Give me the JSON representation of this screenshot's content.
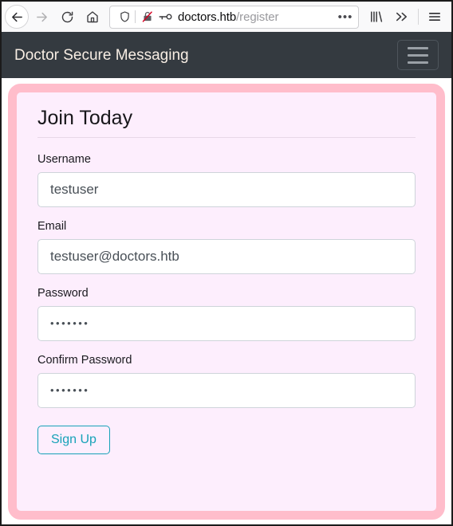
{
  "browser": {
    "back_label": "Back",
    "forward_label": "Forward",
    "reload_label": "Reload",
    "home_label": "Home",
    "url_host": "doctors.htb",
    "url_path": "/register",
    "page_actions_label": "•••",
    "shield_icon": "shield-icon",
    "broken_lock_icon": "broken-padlock-icon",
    "key_icon": "key-icon",
    "library_icon": "library-icon",
    "overflow_icon": "double-chevron-right-icon",
    "menu_icon": "hamburger-menu-icon"
  },
  "navbar": {
    "brand": "Doctor Secure Messaging",
    "toggler_label": "Toggle navigation"
  },
  "card": {
    "heading": "Join Today",
    "fields": [
      {
        "label": "Username",
        "value": "testuser",
        "placeholder": "",
        "type": "text"
      },
      {
        "label": "Email",
        "value": "testuser@doctors.htb",
        "placeholder": "",
        "type": "email"
      },
      {
        "label": "Password",
        "value": "•••••••",
        "placeholder": "",
        "type": "password"
      },
      {
        "label": "Confirm Password",
        "value": "•••••••",
        "placeholder": "",
        "type": "password"
      }
    ],
    "submit_label": "Sign Up"
  },
  "colors": {
    "navbar_bg": "#343a40",
    "card_border": "#ffbdcb",
    "card_bg": "#fdeefd",
    "accent_info": "#17a2b8",
    "chrome_bg": "#f9f9fa"
  }
}
